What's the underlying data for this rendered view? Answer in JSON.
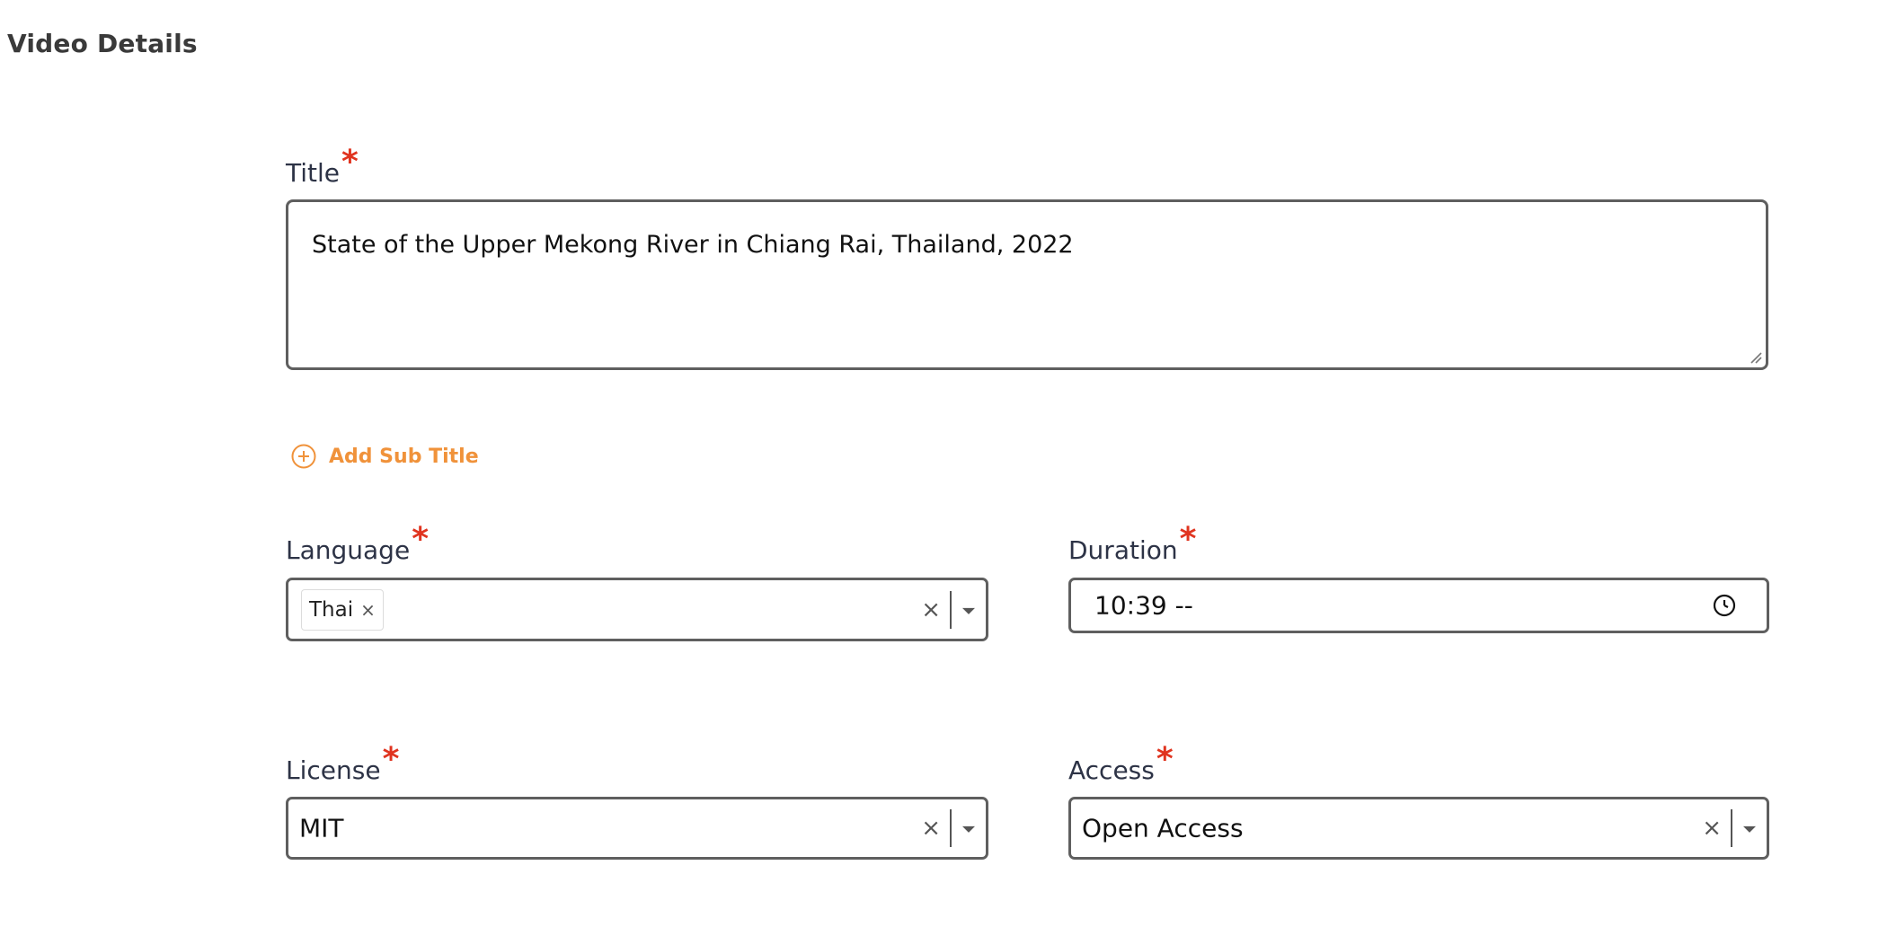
{
  "section": {
    "title": "Video Details"
  },
  "title_field": {
    "label": "Title",
    "required_mark": "*",
    "value": "State of the Upper Mekong River in Chiang Rai, Thailand, 2022"
  },
  "add_subtitle": {
    "label": "Add Sub Title",
    "icon": "plus-circle-icon",
    "color": "#f0923a"
  },
  "language_field": {
    "label": "Language",
    "required_mark": "*",
    "chips": [
      {
        "label": "Thai",
        "remove": "×"
      }
    ],
    "clear": "×"
  },
  "duration_field": {
    "label": "Duration",
    "required_mark": "*",
    "value": "10:39  --",
    "icon": "clock-icon"
  },
  "license_field": {
    "label": "License",
    "required_mark": "*",
    "value": "MIT",
    "clear": "×"
  },
  "access_field": {
    "label": "Access",
    "required_mark": "*",
    "value": "Open Access",
    "clear": "×"
  },
  "colors": {
    "required": "#e0341f",
    "accent": "#f0923a",
    "border": "#5f5f5f"
  }
}
